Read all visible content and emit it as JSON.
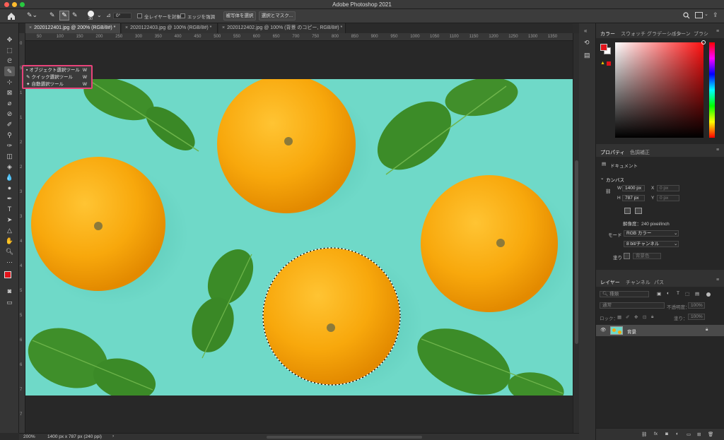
{
  "window": {
    "title": "Adobe Photoshop 2021"
  },
  "options_bar": {
    "brush_size": "30",
    "angle": "0°",
    "sample_all_layers": "全レイヤーを対象",
    "enhance_edge": "エッジを強調",
    "select_subject": "被写体を選択",
    "select_and_mask": "選択とマスク..."
  },
  "tabs": [
    {
      "label": "2020122401.jpg @ 200% (RGB/8#) *"
    },
    {
      "label": "2020122403.jpg @ 100% (RGB/8#) *"
    },
    {
      "label": "2020122402.jpg @ 100% (背景 のコピー, RGB/8#) *"
    }
  ],
  "ruler": {
    "h_ticks": [
      "50",
      "100",
      "150",
      "200",
      "250",
      "300",
      "350",
      "400",
      "450",
      "500",
      "550",
      "600",
      "650",
      "700",
      "750",
      "800",
      "850",
      "900",
      "950",
      "1000",
      "1050",
      "1100",
      "1150",
      "1200",
      "1250",
      "1300",
      "1350"
    ],
    "v_ticks": [
      "0",
      "5",
      "1",
      "1",
      "2",
      "2",
      "3",
      "3",
      "4",
      "4",
      "5",
      "5",
      "6",
      "6",
      "7",
      "7"
    ]
  },
  "flyout": {
    "items": [
      {
        "label": "オブジェクト選択ツール",
        "key": "W"
      },
      {
        "label": "クイック選択ツール",
        "key": "W"
      },
      {
        "label": "自動選択ツール",
        "key": "W"
      }
    ]
  },
  "status": {
    "zoom": "200%",
    "doc_info": "1400 px x 787 px (240 ppi)",
    "arrow": "›"
  },
  "color_panel": {
    "tabs": [
      "カラー",
      "スウォッチ",
      "グラデーション",
      "パターン",
      "ブラシ"
    ],
    "foreground": "#e3131a",
    "background": "#ffffff"
  },
  "properties_panel": {
    "tabs": [
      "プロパティ",
      "色調補正"
    ],
    "doc_label": "ドキュメント",
    "section": "カンバス",
    "w_label": "W",
    "w_value": "1400 px",
    "h_label": "H",
    "h_value": "787 px",
    "x_label": "X",
    "x_value": "0 px",
    "y_label": "Y",
    "y_value": "0 px",
    "resolution": "解像度：240 pixel/inch",
    "mode_label": "モード",
    "mode_value": "RGB カラー",
    "depth_value": "8 bit/チャンネル",
    "fill_label": "塗り",
    "fill_value": "背景色"
  },
  "layers_panel": {
    "tabs": [
      "レイヤー",
      "チャンネル",
      "パス"
    ],
    "filter_placeholder": "種類",
    "blend_mode": "通常",
    "opacity_label": "不透明度：",
    "opacity_value": "100%",
    "lock_label": "ロック：",
    "fill_label": "塗り：",
    "fill_value": "100%",
    "layers": [
      {
        "name": "背景"
      }
    ]
  }
}
